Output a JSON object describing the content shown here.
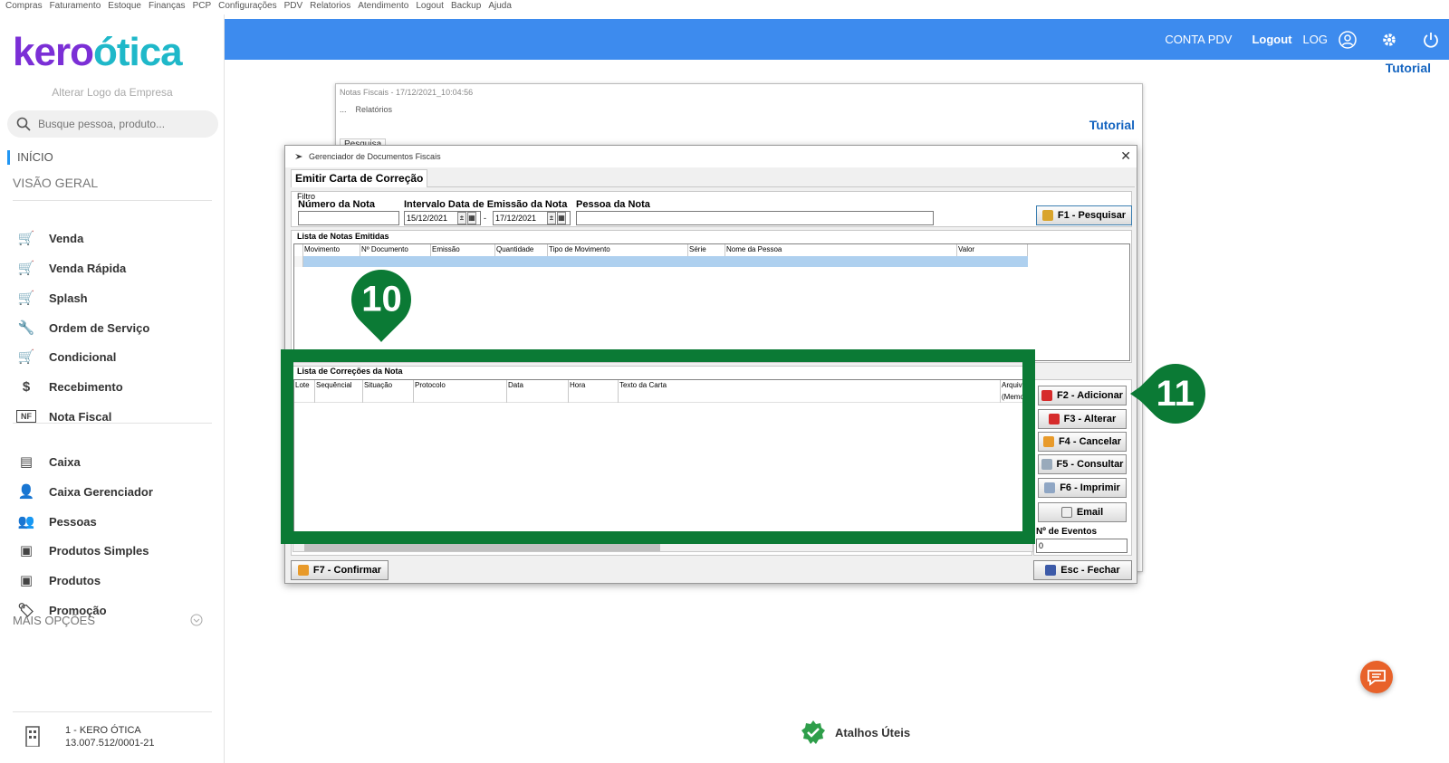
{
  "top_menu": [
    "Compras",
    "Faturamento",
    "Estoque",
    "Finanças",
    "PCP",
    "Configurações",
    "PDV",
    "Relatorios",
    "Atendimento",
    "Logout",
    "Backup",
    "Ajuda"
  ],
  "sidebar": {
    "logo_part1": "kero",
    "logo_part2": "ótica",
    "alter_logo": "Alterar Logo da Empresa",
    "search_placeholder": "Busque pessoa, produto...",
    "inicio": "INÍCIO",
    "visao_geral": "VISÃO GERAL",
    "items": [
      {
        "label": "Venda",
        "icon": "cart-icon"
      },
      {
        "label": "Venda Rápida",
        "icon": "fast-cart-icon"
      },
      {
        "label": "Splash",
        "icon": "splash-cart-icon"
      },
      {
        "label": "Ordem de Serviço",
        "icon": "tools-icon"
      },
      {
        "label": "Condicional",
        "icon": "conditional-cart-icon"
      },
      {
        "label": "Recebimento",
        "icon": "money-hand-icon"
      },
      {
        "label": "Nota Fiscal",
        "icon": "nfe-icon"
      },
      {
        "label": "Caixa",
        "icon": "cash-register-icon"
      },
      {
        "label": "Caixa Gerenciador",
        "icon": "user-money-icon"
      },
      {
        "label": "Pessoas",
        "icon": "people-icon"
      },
      {
        "label": "Produtos Simples",
        "icon": "box-icon"
      },
      {
        "label": "Produtos",
        "icon": "box-icon"
      },
      {
        "label": "Promoção",
        "icon": "tag-icon"
      }
    ],
    "mais_opcoes": "MAIS OPÇÕES",
    "company_name": "1 - KERO ÓTICA",
    "company_cnpj": "13.007.512/0001-21"
  },
  "header": {
    "conta_pdv": "CONTA PDV",
    "logout": "Logout",
    "log": "LOG",
    "tutorial": "Tutorial",
    "color": "#3d8bee"
  },
  "bg_window": {
    "title": "Notas Fiscais - 17/12/2021_10:04:56",
    "menu_dots": "...",
    "menu_relatorios": "Relatórios",
    "tutorial": "Tutorial",
    "tab": "Pesquisa"
  },
  "dialog": {
    "title": "Gerenciador de Documentos Fiscais",
    "tab": "Emitir Carta de Correção",
    "filtro": "Filtro",
    "numero_nota_label": "Número da Nota",
    "numero_nota_value": "",
    "intervalo_label": "Intervalo Data de Emissão da Nota",
    "date_from": "15/12/2021",
    "date_sep": "-",
    "date_to": "17/12/2021",
    "pessoa_label": "Pessoa da Nota",
    "pessoa_value": "",
    "btn_pesquisar": "F1 - Pesquisar",
    "lista_notas": "Lista de Notas Emitidas",
    "notas_columns": [
      "Movimento",
      "Nº Documento",
      "Emissão",
      "Quantidade",
      "Tipo de Movimento",
      "Série",
      "Nome da Pessoa",
      "Valor"
    ],
    "lista_correcoes": "Lista de Correções da Nota",
    "correcoes_columns": [
      "Lote",
      "Sequêncial",
      "Situação",
      "Protocolo",
      "Data",
      "Hora",
      "Texto da Carta",
      "Arquivo"
    ],
    "correcoes_row_memo": "(Memo)",
    "btn_adicionar": "F2 - Adicionar",
    "btn_alterar": "F3 - Alterar",
    "btn_cancelar": "F4 - Cancelar",
    "btn_consultar": "F5 - Consultar",
    "btn_imprimir": "F6 - Imprimir",
    "btn_email": "Email",
    "eventos_label": "Nº de Eventos",
    "eventos_value": "0",
    "btn_confirmar": "F7 - Confirmar",
    "btn_fechar": "Esc - Fechar"
  },
  "annotations": {
    "marker10": "10",
    "marker11": "11",
    "color": "#0b7a35"
  },
  "footer": {
    "atalhos": "Atalhos Úteis"
  }
}
